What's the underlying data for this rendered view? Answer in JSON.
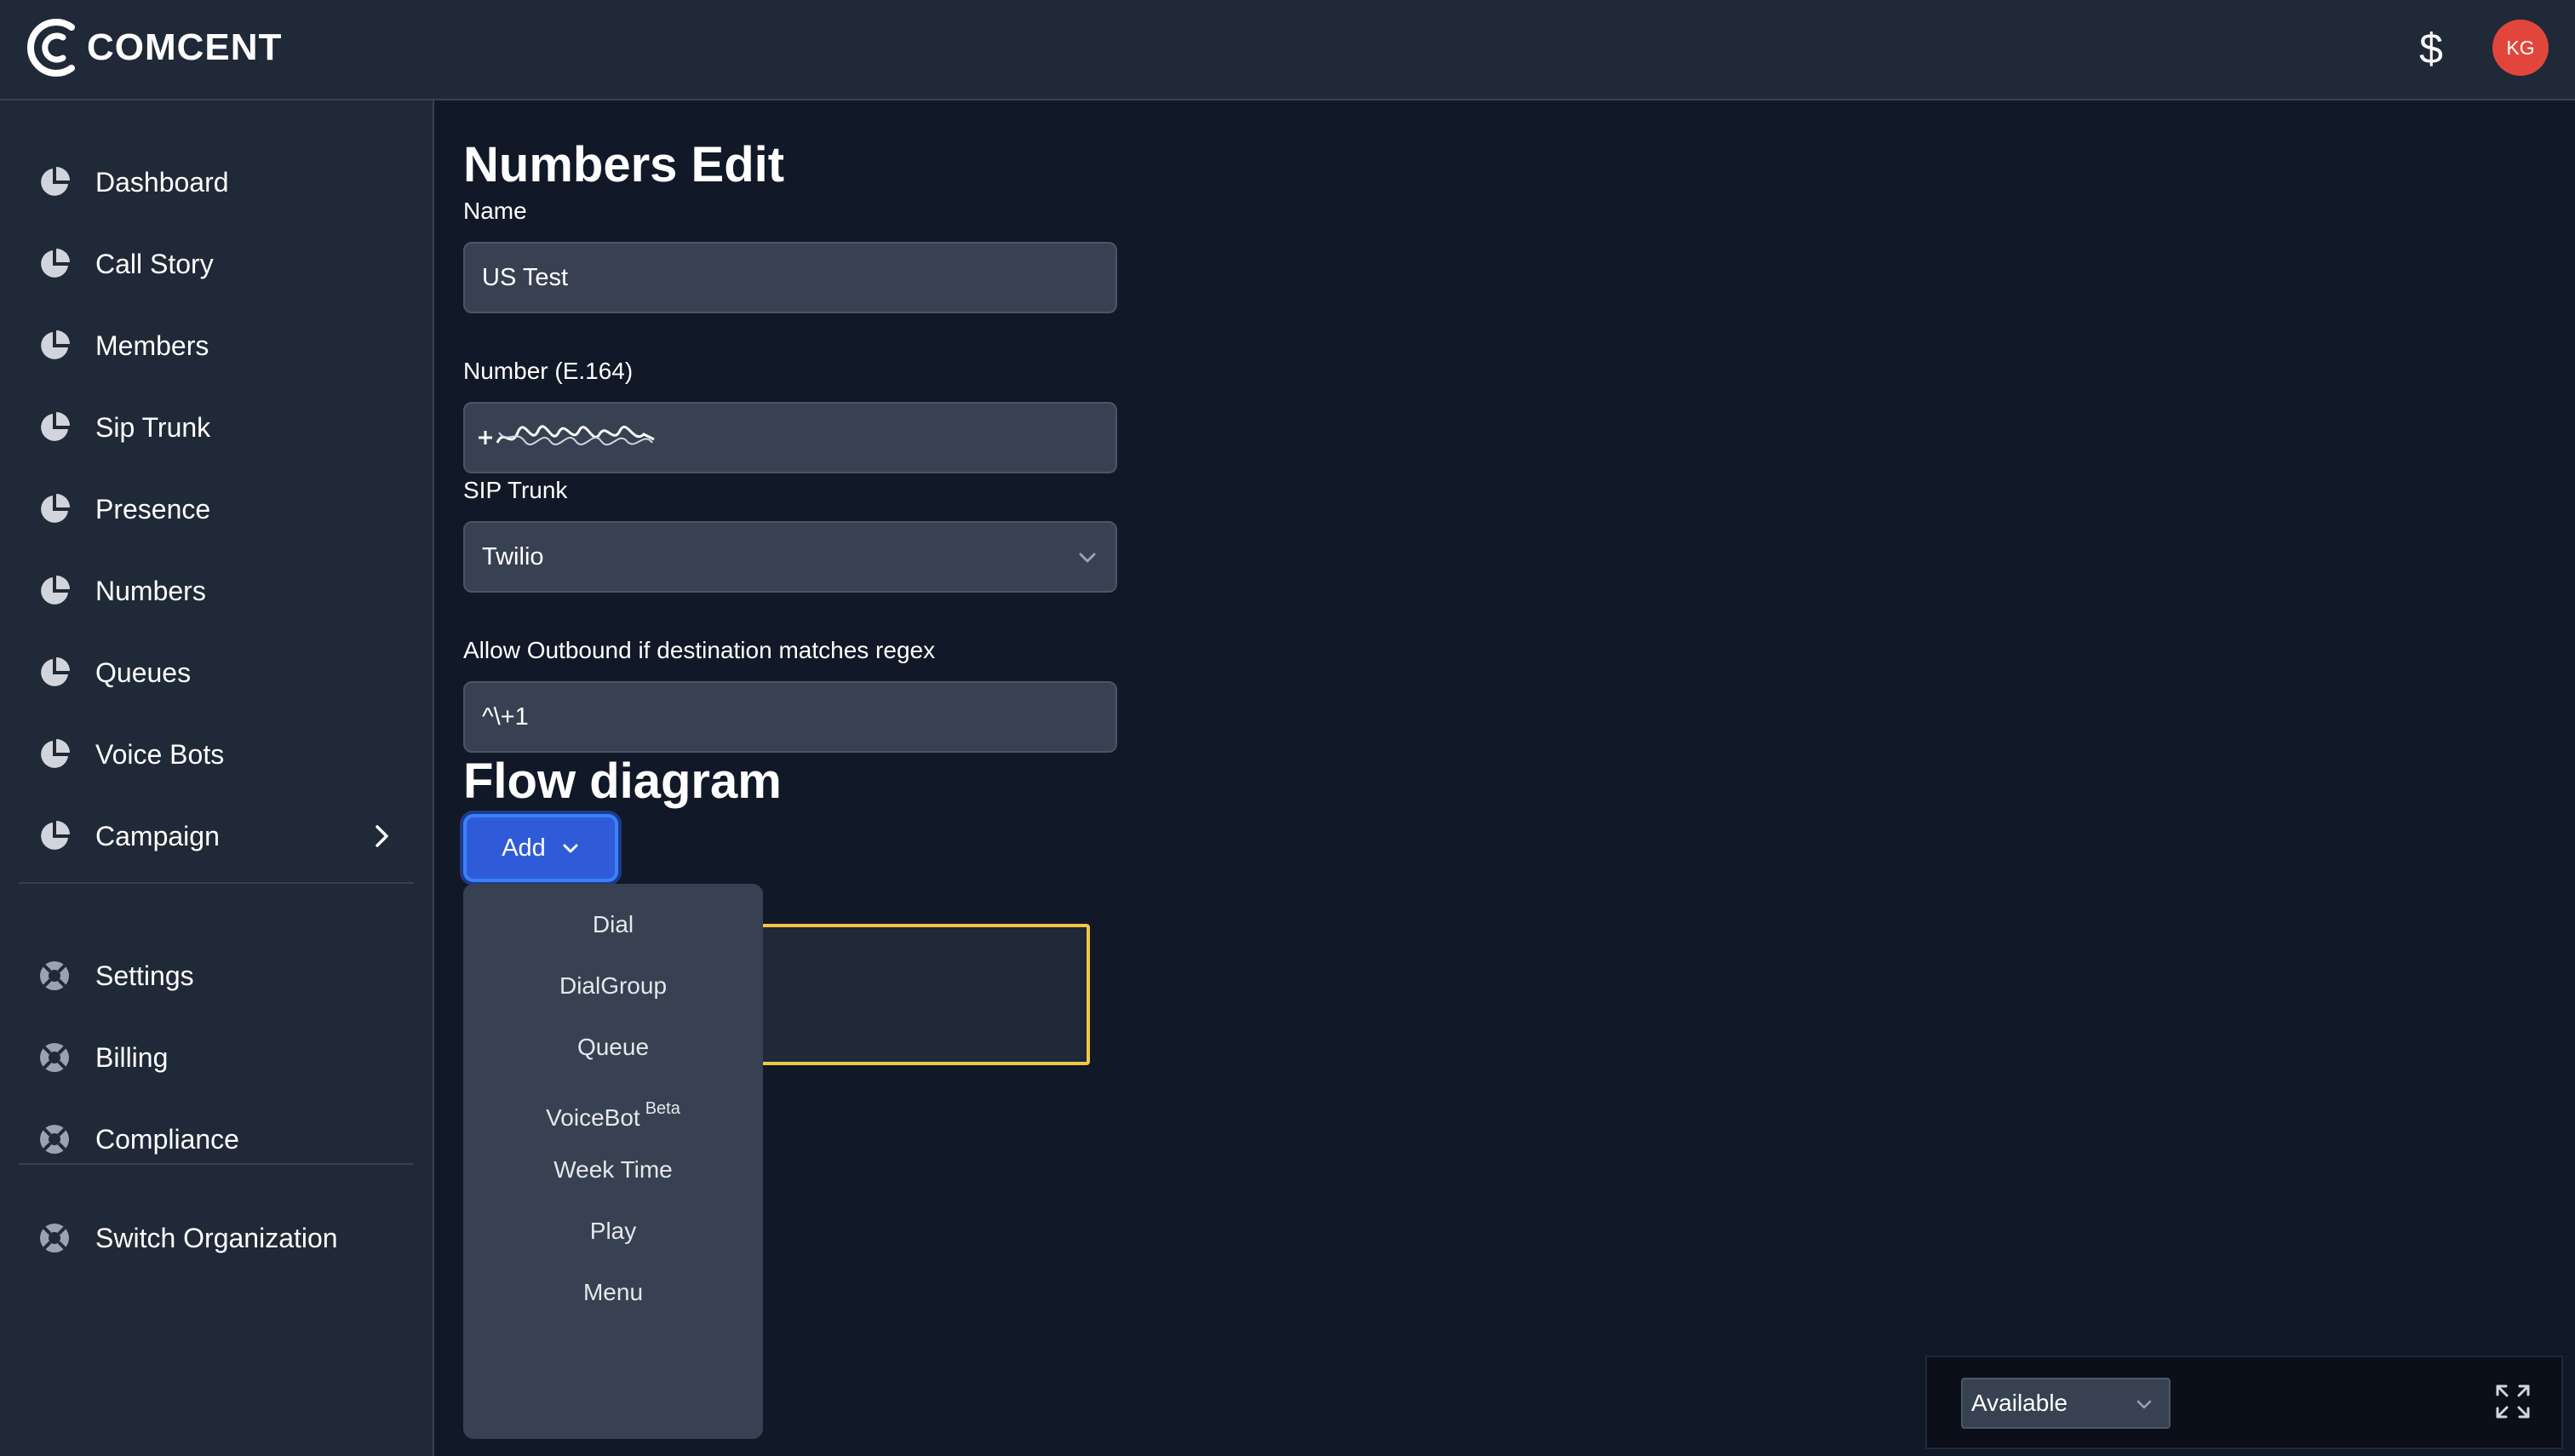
{
  "app": {
    "brand": "COMCENT"
  },
  "header": {
    "currency_icon": "dollar-icon",
    "avatar_initials": "KG",
    "avatar_color": "#e2453b"
  },
  "sidebar": {
    "items": [
      {
        "label": "Dashboard",
        "icon": "pie-chart-icon"
      },
      {
        "label": "Call Story",
        "icon": "pie-chart-icon"
      },
      {
        "label": "Members",
        "icon": "pie-chart-icon"
      },
      {
        "label": "Sip Trunk",
        "icon": "pie-chart-icon"
      },
      {
        "label": "Presence",
        "icon": "pie-chart-icon"
      },
      {
        "label": "Numbers",
        "icon": "pie-chart-icon"
      },
      {
        "label": "Queues",
        "icon": "pie-chart-icon"
      },
      {
        "label": "Voice Bots",
        "icon": "pie-chart-icon"
      },
      {
        "label": "Campaign",
        "icon": "pie-chart-icon",
        "has_submenu": true
      }
    ],
    "secondary": [
      {
        "label": "Settings",
        "icon": "lifebuoy-icon"
      },
      {
        "label": "Billing",
        "icon": "lifebuoy-icon"
      },
      {
        "label": "Compliance",
        "icon": "lifebuoy-icon"
      }
    ],
    "tertiary": [
      {
        "label": "Switch Organization",
        "icon": "lifebuoy-icon"
      }
    ]
  },
  "form": {
    "title": "Numbers Edit",
    "name_label": "Name",
    "name_value": "US Test",
    "number_label": "Number (E.164)",
    "number_value": "",
    "sip_trunk_label": "SIP Trunk",
    "sip_trunk_value": "Twilio",
    "regex_label": "Allow Outbound if destination matches regex",
    "regex_value": "^\\+1"
  },
  "flow": {
    "title": "Flow diagram",
    "add_label": "Add",
    "menu": [
      {
        "label": "Dial"
      },
      {
        "label": "DialGroup"
      },
      {
        "label": "Queue"
      },
      {
        "label": "VoiceBot",
        "badge": "Beta"
      },
      {
        "label": "Week Time"
      },
      {
        "label": "Play"
      },
      {
        "label": "Menu"
      }
    ]
  },
  "status": {
    "value": "Available"
  },
  "colors": {
    "accent": "#2f5bd9",
    "highlight": "#f2c744",
    "background": "#111827",
    "panel": "#1f2937"
  }
}
